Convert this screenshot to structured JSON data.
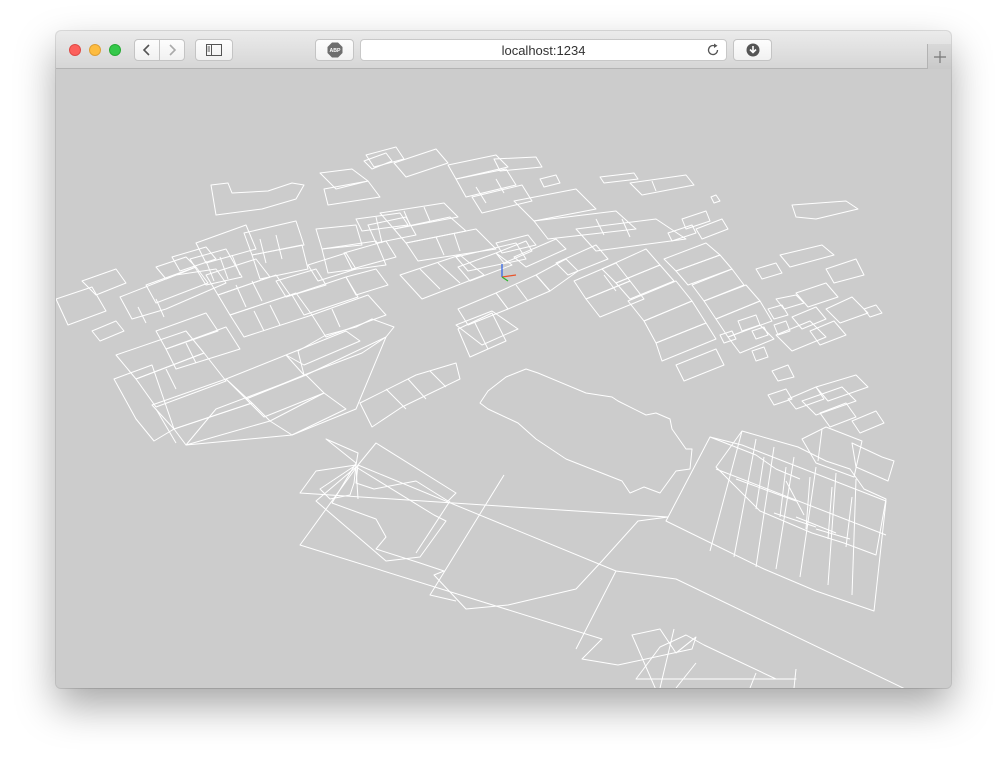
{
  "browser": {
    "url": "localhost:1234",
    "abp_label": "ABP"
  },
  "icons": {
    "back": "chevron-left-icon",
    "forward": "chevron-right-icon",
    "sidebar": "sidebar-icon",
    "adblock": "adblock-icon",
    "reload": "reload-icon",
    "download": "download-icon",
    "new_tab": "plus-icon"
  },
  "colors": {
    "canvas_background": "#cccccc",
    "parcel_outline": "#ffffff",
    "axis_x": "#e8542a",
    "axis_y": "#2a5ee8",
    "axis_z": "#2eb82e"
  }
}
